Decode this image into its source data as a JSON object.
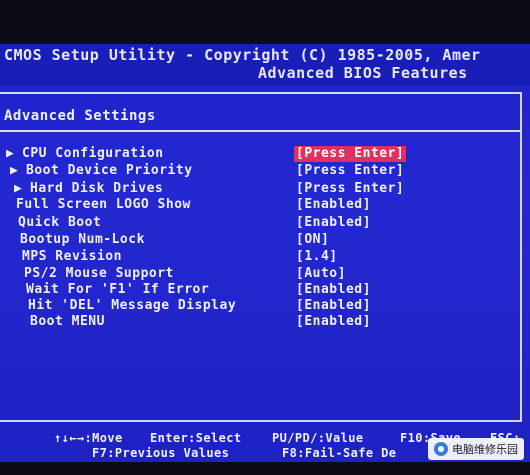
{
  "header": {
    "title_line": "CMOS Setup Utility - Copyright (C) 1985-2005, Amer",
    "subtitle": "Advanced BIOS Features"
  },
  "section": {
    "title": "Advanced Settings"
  },
  "items": [
    {
      "label": "CPU Configuration",
      "value": "[Press Enter]",
      "submenu": true,
      "selected": true
    },
    {
      "label": "Boot Device Priority",
      "value": "[Press Enter]",
      "submenu": true,
      "selected": false
    },
    {
      "label": "Hard Disk Drives",
      "value": "[Press Enter]",
      "submenu": true,
      "selected": false
    },
    {
      "label": "Full Screen LOGO Show",
      "value": "[Enabled]",
      "submenu": false,
      "selected": false
    },
    {
      "label": "Quick Boot",
      "value": "[Enabled]",
      "submenu": false,
      "selected": false
    },
    {
      "label": "Bootup Num-Lock",
      "value": "[ON]",
      "submenu": false,
      "selected": false
    },
    {
      "label": "MPS Revision",
      "value": "[1.4]",
      "submenu": false,
      "selected": false
    },
    {
      "label": "PS/2 Mouse Support",
      "value": "[Auto]",
      "submenu": false,
      "selected": false
    },
    {
      "label": "Wait For 'F1' If Error",
      "value": "[Enabled]",
      "submenu": false,
      "selected": false
    },
    {
      "label": "Hit 'DEL' Message Display",
      "value": "[Enabled]",
      "submenu": false,
      "selected": false
    },
    {
      "label": "Boot MENU",
      "value": "[Enabled]",
      "submenu": false,
      "selected": false
    }
  ],
  "submenu_arrow": "▶",
  "help": {
    "move": "↑↓←→:Move",
    "enter": "Enter:Select",
    "value": "PU/PD/:Value",
    "save": "F10:Save",
    "esc": "ESC:",
    "prev": "F7:Previous Values",
    "failsafe": "F8:Fail-Safe De"
  },
  "watermark": {
    "text": "电脑维修乐园",
    "icon": "wechat-logo-icon"
  },
  "colors": {
    "background": "#2428d0",
    "text": "#f0f0f8",
    "highlight": "#e03060"
  }
}
